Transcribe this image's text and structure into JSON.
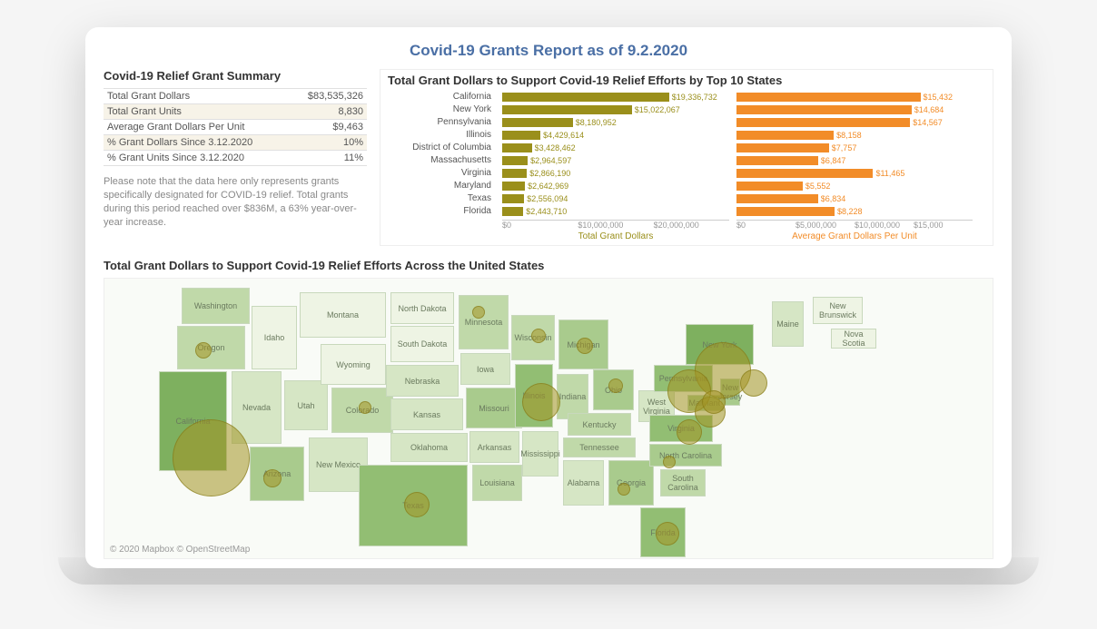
{
  "dash_title": "Covid-19 Grants Report as of 9.2.2020",
  "summary": {
    "title": "Covid-19 Relief Grant Summary",
    "rows": [
      {
        "label": "Total Grant Dollars",
        "value": "$83,535,326"
      },
      {
        "label": "Total Grant Units",
        "value": "8,830"
      },
      {
        "label": "Average Grant Dollars Per Unit",
        "value": "$9,463"
      },
      {
        "label": "% Grant Dollars Since 3.12.2020",
        "value": "10%"
      },
      {
        "label": "% Grant Units Since 3.12.2020",
        "value": "11%"
      }
    ],
    "note": "Please note that the data here only represents grants specifically designated for COVID-19 relief. Total grants during this period reached over $836M, a 63% year-over-year increase."
  },
  "charts_title": "Total Grant Dollars to Support Covid-19 Relief  Efforts by Top 10 States",
  "states": [
    "California",
    "New York",
    "Pennsylvania",
    "Illinois",
    "District of Columbia",
    "Massachusetts",
    "Virginia",
    "Maryland",
    "Texas",
    "Florida"
  ],
  "dollar_labels": [
    "$19,336,732",
    "$15,022,067",
    "$8,180,952",
    "$4,429,614",
    "$3,428,462",
    "$2,964,597",
    "$2,866,190",
    "$2,642,969",
    "$2,556,094",
    "$2,443,710"
  ],
  "avg_labels": [
    "$15,432",
    "$14,684",
    "$14,567",
    "$8,158",
    "$7,757",
    "$6,847",
    "$11,465",
    "$5,552",
    "$6,834",
    "$8,228"
  ],
  "dollar_axis_ticks": [
    "$0",
    "$10,000,000",
    "$20,000,000"
  ],
  "avg_axis_ticks": [
    "$0",
    "$5,000,000",
    "$10,000,000",
    "$15,000"
  ],
  "dollar_axis_label": "Total Grant Dollars",
  "avg_axis_label": "Average Grant Dollars Per Unit",
  "map_title": "Total Grant Dollars to Support Covid-19 Relief Efforts Across the United States",
  "attribution": "© 2020 Mapbox © OpenStreetMap",
  "map_state_labels": {
    "WA": "Washington",
    "OR": "Oregon",
    "CA": "California",
    "NV": "Nevada",
    "ID": "Idaho",
    "MT": "Montana",
    "WY": "Wyoming",
    "UT": "Utah",
    "CO": "Colorado",
    "AZ": "Arizona",
    "NM": "New Mexico",
    "ND": "North Dakota",
    "SD": "South Dakota",
    "NE": "Nebraska",
    "KS": "Kansas",
    "OK": "Oklahoma",
    "TX": "Texas",
    "MN": "Minnesota",
    "IA": "Iowa",
    "MO": "Missouri",
    "AR": "Arkansas",
    "LA": "Louisiana",
    "WI": "Wisconsin",
    "IL": "Illinois",
    "MS": "Mississippi",
    "MI": "Michigan",
    "IN": "Indiana",
    "OH": "Ohio",
    "KY": "Kentucky",
    "TN": "Tennessee",
    "AL": "Alabama",
    "GA": "Georgia",
    "FL": "Florida",
    "WV": "West Virginia",
    "VA": "Virginia",
    "NC": "North Carolina",
    "SC": "South Carolina",
    "PA": "Pennsylvania",
    "NY": "New York",
    "ME": "Maine",
    "NB": "New Brunswick",
    "NS": "Nova Scotia",
    "MD": "Maryland",
    "NJ": "New Jersey"
  },
  "chart_data": [
    {
      "type": "bar",
      "title": "Total Grant Dollars to Support Covid-19 Relief Efforts by Top 10 States",
      "orientation": "horizontal",
      "series": [
        {
          "name": "Total Grant Dollars",
          "color": "#9a8f1b",
          "categories": [
            "California",
            "New York",
            "Pennsylvania",
            "Illinois",
            "District of Columbia",
            "Massachusetts",
            "Virginia",
            "Maryland",
            "Texas",
            "Florida"
          ],
          "values": [
            19336732,
            15022067,
            8180952,
            4429614,
            3428462,
            2964597,
            2866190,
            2642969,
            2556094,
            2443710
          ],
          "xlabel": "Total Grant Dollars",
          "xlim": [
            0,
            20000000
          ]
        },
        {
          "name": "Average Grant Dollars Per Unit",
          "color": "#f28c28",
          "categories": [
            "California",
            "New York",
            "Pennsylvania",
            "Illinois",
            "District of Columbia",
            "Massachusetts",
            "Virginia",
            "Maryland",
            "Texas",
            "Florida"
          ],
          "values": [
            15432,
            14684,
            14567,
            8158,
            7757,
            6847,
            11465,
            5552,
            6834,
            8228
          ],
          "xlabel": "Average Grant Dollars Per Unit",
          "xlim": [
            0,
            16000
          ]
        }
      ]
    },
    {
      "type": "map",
      "title": "Total Grant Dollars to Support Covid-19 Relief Efforts Across the United States",
      "region": "United States",
      "encoding": "bubble size ≈ total grant dollars; state fill ≈ relative grant level",
      "notable_bubbles": [
        {
          "state": "California",
          "approx_value": 19336732,
          "size": "largest"
        },
        {
          "state": "New York",
          "approx_value": 15022067,
          "size": "very large"
        },
        {
          "state": "Pennsylvania",
          "approx_value": 8180952,
          "size": "large"
        },
        {
          "state": "Illinois",
          "approx_value": 4429614,
          "size": "large"
        },
        {
          "state": "District of Columbia",
          "approx_value": 3428462,
          "size": "medium"
        },
        {
          "state": "Massachusetts",
          "approx_value": 2964597,
          "size": "medium"
        },
        {
          "state": "Virginia",
          "approx_value": 2866190,
          "size": "medium"
        },
        {
          "state": "Maryland",
          "approx_value": 2642969,
          "size": "medium"
        },
        {
          "state": "Texas",
          "approx_value": 2556094,
          "size": "medium"
        },
        {
          "state": "Florida",
          "approx_value": 2443710,
          "size": "medium"
        }
      ]
    }
  ]
}
